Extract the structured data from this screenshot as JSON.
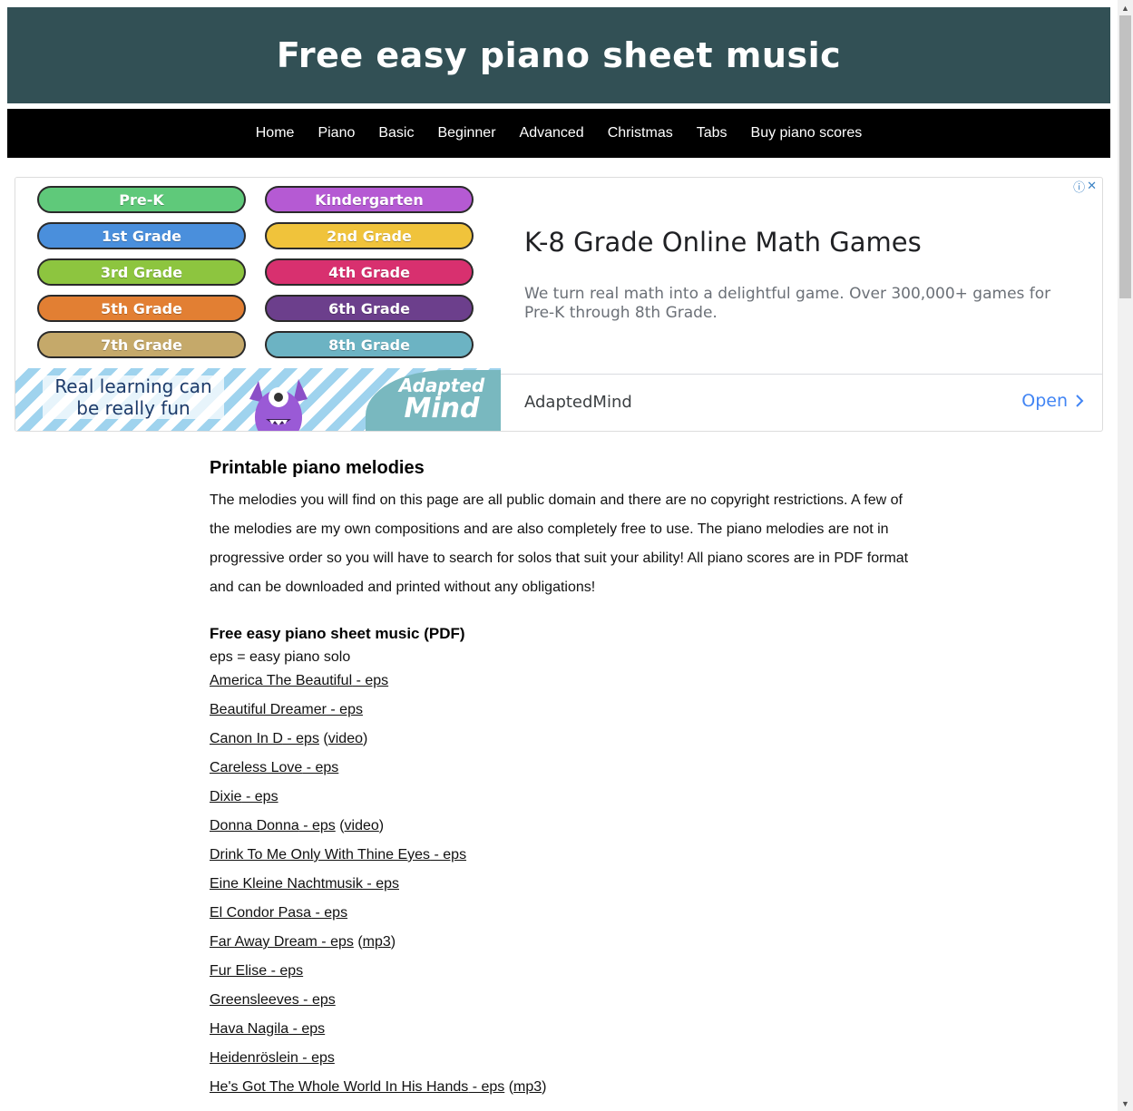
{
  "header": {
    "title": "Free easy piano sheet music"
  },
  "nav": {
    "items": [
      "Home",
      "Piano",
      "Basic",
      "Beginner",
      "Advanced",
      "Christmas",
      "Tabs",
      "Buy piano scores"
    ]
  },
  "ad": {
    "grades": [
      {
        "label": "Pre-K",
        "color": "#5fc97a"
      },
      {
        "label": "Kindergarten",
        "color": "#b55ad3"
      },
      {
        "label": "1st Grade",
        "color": "#4a8fdc"
      },
      {
        "label": "2nd Grade",
        "color": "#f0c33b"
      },
      {
        "label": "3rd Grade",
        "color": "#8dc53f"
      },
      {
        "label": "4th Grade",
        "color": "#d8306f"
      },
      {
        "label": "5th Grade",
        "color": "#e27f33"
      },
      {
        "label": "6th Grade",
        "color": "#6c3f8c"
      },
      {
        "label": "7th Grade",
        "color": "#c5a96a"
      },
      {
        "label": "8th Grade",
        "color": "#6cb3c3"
      }
    ],
    "banner_text": "Real learning can be really fun",
    "brand_line1": "Adapted",
    "brand_line2": "Mind",
    "title": "K-8 Grade Online Math Games",
    "description": "We turn real math into a delightful game. Over 300,000+ games for Pre-K through 8th Grade.",
    "advertiser": "AdaptedMind",
    "open_label": "Open",
    "info_icon": "ⓘ",
    "close_icon": "✕"
  },
  "content": {
    "heading": "Printable piano melodies",
    "intro": "The melodies you will find on this page are all public domain and there are no copyright restrictions. A few of the melodies are my own compositions and are also completely free to use. The piano melodies are not in progressive order so you will have to search for solos that suit your ability! All piano scores are in PDF format and can be downloaded and printed without any obligations!",
    "subheading": "Free easy piano sheet music (PDF)",
    "legend": "eps = easy piano solo",
    "songs": [
      {
        "title": "America The Beautiful",
        "extra": ""
      },
      {
        "title": "Beautiful Dreamer",
        "extra": ""
      },
      {
        "title": "Canon In D",
        "extra": "video"
      },
      {
        "title": "Careless Love",
        "extra": ""
      },
      {
        "title": "Dixie",
        "extra": ""
      },
      {
        "title": "Donna Donna",
        "extra": "video"
      },
      {
        "title": "Drink To Me Only With Thine Eyes",
        "extra": ""
      },
      {
        "title": "Eine Kleine Nachtmusik",
        "extra": ""
      },
      {
        "title": "El Condor Pasa",
        "extra": ""
      },
      {
        "title": "Far Away Dream",
        "extra": "mp3"
      },
      {
        "title": "Fur Elise",
        "extra": ""
      },
      {
        "title": "Greensleeves",
        "extra": ""
      },
      {
        "title": "Hava Nagila",
        "extra": ""
      },
      {
        "title": "Heidenröslein",
        "extra": ""
      },
      {
        "title": "He's Got The Whole World In His Hands",
        "extra": "mp3"
      }
    ],
    "suffix": " - eps"
  }
}
